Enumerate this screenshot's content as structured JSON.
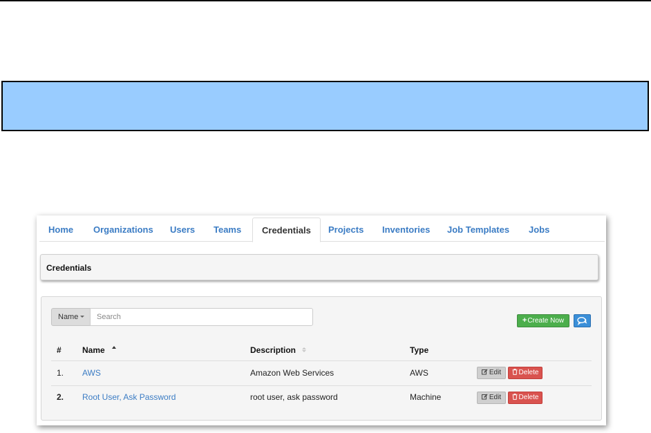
{
  "tabs": [
    {
      "label": "Home"
    },
    {
      "label": "Organizations"
    },
    {
      "label": "Users"
    },
    {
      "label": "Teams"
    },
    {
      "label": "Credentials",
      "active": true
    },
    {
      "label": "Projects"
    },
    {
      "label": "Inventories"
    },
    {
      "label": "Job Templates"
    },
    {
      "label": "Jobs"
    }
  ],
  "page_title": "Credentials",
  "search": {
    "field_label": "Name",
    "placeholder": "Search"
  },
  "toolbar": {
    "create_label": "Create Now",
    "create_icon": "plus-icon",
    "chat_icon": "chat-icon"
  },
  "table": {
    "headers": {
      "index": "#",
      "name": "Name",
      "description": "Description",
      "type": "Type"
    },
    "sort": {
      "column": "name",
      "direction": "asc"
    },
    "rows": [
      {
        "index": "1.",
        "name": "AWS",
        "description": "Amazon Web Services",
        "type": "AWS"
      },
      {
        "index": "2.",
        "name": "Root User, Ask Password",
        "description": "root user, ask password",
        "type": "Machine"
      }
    ],
    "edit_label": "Edit",
    "delete_label": "Delete"
  },
  "colors": {
    "banner": "#99ccff",
    "link": "#3b7cc4",
    "create_button": "#4cae4c",
    "delete_button": "#d9534f",
    "chat_button": "#3b8fd8"
  }
}
